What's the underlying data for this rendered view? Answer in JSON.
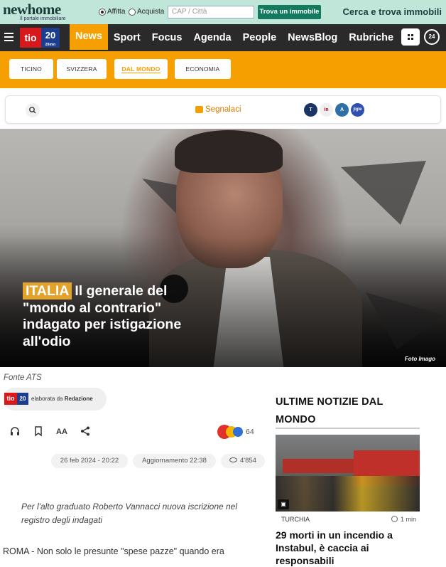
{
  "ad": {
    "brand": "newhome",
    "tagline": "Il portale immobiliare",
    "radio_rent": "Affitta",
    "radio_buy": "Acquista",
    "location_placeholder": "CAP / Città",
    "find_button": "Trova un immobile",
    "slogan": "Cerca e trova immobili"
  },
  "header": {
    "logo_text": "tio",
    "logo_number": "20",
    "logo_sub": "20min",
    "nav_items": [
      "News",
      "Sport",
      "Focus",
      "Agenda",
      "People",
      "NewsBlog",
      "Rubriche"
    ],
    "active_item": "News",
    "live_badge": "24"
  },
  "subnav": {
    "items": [
      "TICINO",
      "SVIZZERA",
      "DAL MONDO",
      "ECONOMIA"
    ],
    "active": "DAL MONDO"
  },
  "toolbar": {
    "report_label": "Segnalaci",
    "socials": [
      "T",
      "in",
      "A",
      "jigle"
    ]
  },
  "hero": {
    "kicker": "ITALIA",
    "title": "Il generale del \"mondo al contrario\" indagato per istigazione all'odio",
    "photo_credit": "Foto Imago"
  },
  "article": {
    "source": "Fonte ATS",
    "author_prefix": "elaborata da",
    "author": "Redazione",
    "reactions_count": "64",
    "date": "26 feb 2024 - 20:22",
    "updated": "Aggiornamento 22:38",
    "views": "4'854",
    "lead": "Per l'alto graduato Roberto Vannacci nuova iscrizione nel registro degli indagati",
    "body_start": "ROMA - Non solo le presunte \"spese pazze\" quando era"
  },
  "sidebar": {
    "section_title": "ULTIME NOTIZIE DAL MONDO",
    "news": [
      {
        "category": "TURCHIA",
        "time": "1 min",
        "title": "29 morti in un incendio a Instabul, è caccia ai responsabili"
      }
    ]
  },
  "colors": {
    "accent_orange": "#f5a000",
    "nav_dark": "#2a2a2a",
    "tio_red": "#d7191c",
    "tio_blue": "#1d3e8f",
    "ad_green": "#bfe6d9",
    "button_green": "#137a5d"
  }
}
